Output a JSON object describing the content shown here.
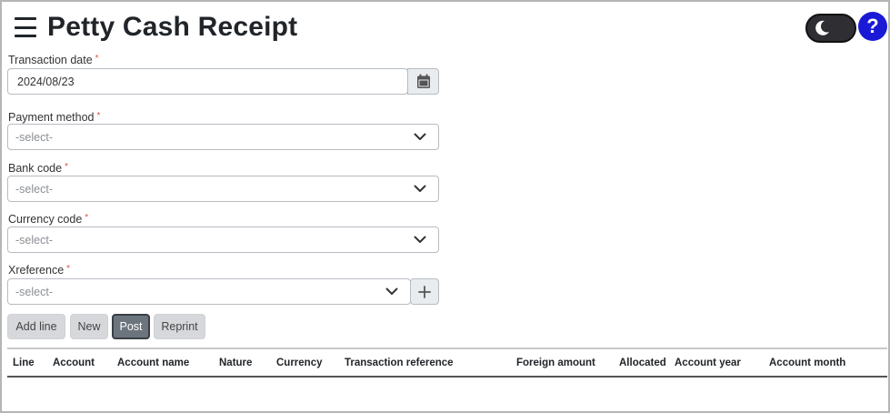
{
  "header": {
    "title": "Petty Cash Receipt"
  },
  "form": {
    "transaction_date": {
      "label": "Transaction date",
      "required_mark": "*",
      "value": "2024/08/23"
    },
    "payment_method": {
      "label": "Payment method",
      "required_mark": "*",
      "value": "-select-"
    },
    "bank_code": {
      "label": "Bank code",
      "required_mark": "*",
      "value": "-select-"
    },
    "currency_code": {
      "label": "Currency code",
      "required_mark": "*",
      "value": "-select-"
    },
    "xreference": {
      "label": "Xreference",
      "required_mark": "*",
      "value": "-select-"
    }
  },
  "buttons": {
    "add_line": "Add line",
    "new": "New",
    "post": "Post",
    "reprint": "Reprint"
  },
  "table": {
    "columns": [
      "Line",
      "Account",
      "Account name",
      "Nature",
      "Currency",
      "Transaction reference",
      "Foreign amount",
      "Allocated",
      "Account year",
      "Account month"
    ]
  },
  "icons": {
    "menu": "hamburger-icon",
    "theme": "moon-icon",
    "help": "question-icon",
    "calendar": "calendar-icon",
    "dropdown": "chevron-down-icon",
    "add": "plus-icon"
  },
  "colors": {
    "help_button": "#1a1ad6",
    "post_button": "#6c757d",
    "required": "#e0534a"
  }
}
